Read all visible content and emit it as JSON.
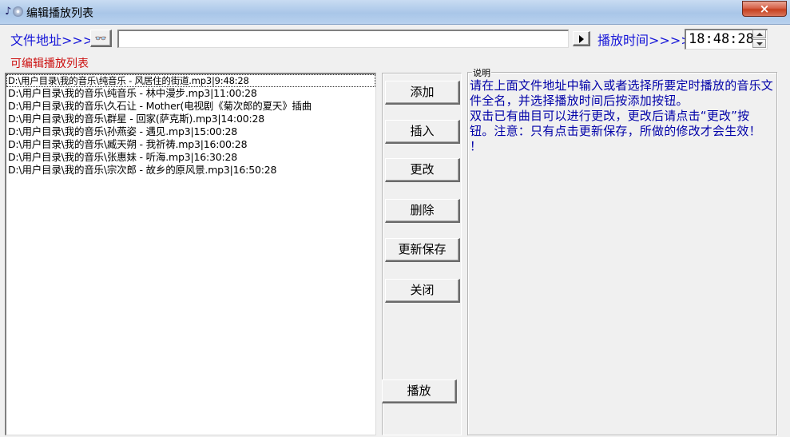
{
  "window": {
    "title": "编辑播放列表",
    "close_glyph": "×",
    "app_icon": "music-disc-icon",
    "close_color": "#d7634b"
  },
  "toolbar": {
    "file_address_label": "文件地址>>>",
    "browse_icon": "binoculars-icon",
    "browse_glyph": "👓",
    "file_input_value": "",
    "play_time_label": "播放时间>>>>",
    "play_time_value": "18:48:28"
  },
  "playlist": {
    "header": "可编辑播放列表",
    "items": [
      "D:\\用户目录\\我的音乐\\纯音乐 - 风居住的街道.mp3|9:48:28",
      "D:\\用户目录\\我的音乐\\纯音乐 - 林中漫步.mp3|11:00:28",
      "D:\\用户目录\\我的音乐\\久石让 - Mother(电视剧《菊次郎的夏天》插曲",
      "D:\\用户目录\\我的音乐\\群星 - 回家(萨克斯).mp3|14:00:28",
      "D:\\用户目录\\我的音乐\\孙燕姿 - 遇见.mp3|15:00:28",
      "D:\\用户目录\\我的音乐\\臧天朔 - 我祈祷.mp3|16:00:28",
      "D:\\用户目录\\我的音乐\\张惠妹 - 听海.mp3|16:30:28",
      "D:\\用户目录\\我的音乐\\宗次郎 - 故乡的原风景.mp3|16:50:28"
    ]
  },
  "actions": {
    "add": "添加",
    "insert": "插入",
    "modify": "更改",
    "delete": "删除",
    "save": "更新保存",
    "close": "关闭",
    "play": "播放"
  },
  "description": {
    "legend": "说明",
    "text": "请在上面文件地址中输入或者选择所要定时播放的音乐文件全名，并选择播放时间后按添加按钮。\n双击已有曲目可以进行更改，更改后请点击“更改”按钮。注意：只有点击更新保存，所做的修改才会生效！\n！"
  },
  "colors": {
    "label_blue": "#1515d8",
    "label_red": "#cc1010",
    "desc_text": "#0000a8"
  }
}
